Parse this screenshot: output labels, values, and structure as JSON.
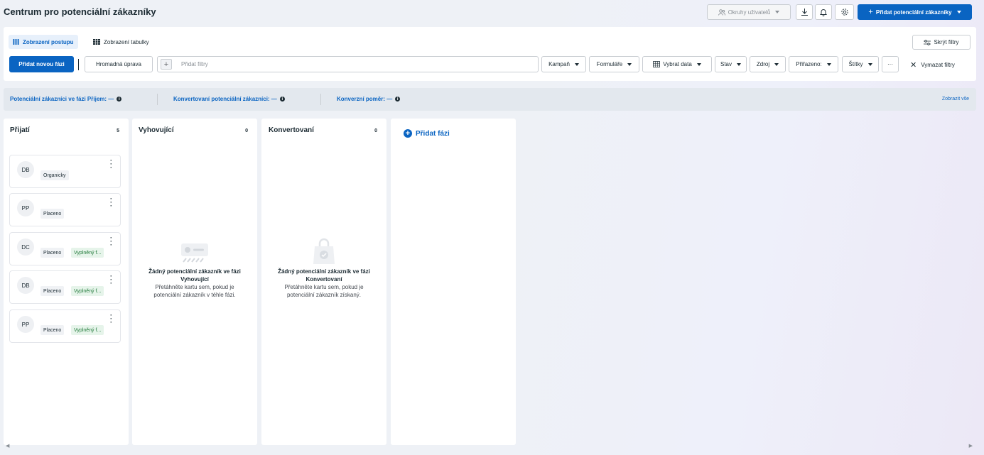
{
  "header": {
    "title": "Centrum pro potenciální zákazníky",
    "audience_btn": "Okruhy uživatelů",
    "add_leads_btn": "Přidat potenciální zákazníky"
  },
  "views": {
    "pipeline": "Zobrazení postupu",
    "table": "Zobrazení tabulky"
  },
  "toolbar": {
    "add_phase_btn": "Přidat novou fázi",
    "bulk_edit_btn": "Hromadná úprava",
    "filter_placeholder": "Přidat filtry",
    "hide_filters_btn": "Skrýt filtry",
    "filters": [
      "Kampaň",
      "Formuláře",
      "Vybrat data",
      "Stav",
      "Zdroj",
      "Přiřazeno:",
      "Štítky"
    ],
    "more_btn": "···",
    "clear_filters": "Vymazat filtry"
  },
  "stats": {
    "received": "Potenciální zákazníci ve fázi Příjem: —",
    "converted": "Konvertovaní potenciální zákazníci: —",
    "rate": "Konverzní poměr: —",
    "show_all": "Zobrazit vše"
  },
  "columns": [
    {
      "title": "Přijatí",
      "count": "5",
      "cards": [
        {
          "initials": "DB",
          "tags": [
            "Organicky"
          ]
        },
        {
          "initials": "PP",
          "tags": [
            "Placeno"
          ]
        },
        {
          "initials": "DC",
          "tags": [
            "Placeno",
            "Vyplněný f..."
          ]
        },
        {
          "initials": "DB",
          "tags": [
            "Placeno",
            "Vyplněný f..."
          ]
        },
        {
          "initials": "PP",
          "tags": [
            "Placeno",
            "Vyplněný f..."
          ]
        }
      ]
    },
    {
      "title": "Vyhovující",
      "count": "0",
      "empty_title": "Žádný potenciální zákazník ve fázi Vyhovující",
      "empty_text": "Přetáhněte kartu sem, pokud je potenciální zákazník v téhle fázi."
    },
    {
      "title": "Konvertovaní",
      "count": "0",
      "empty_title": "Žádný potenciální zákazník ve fázi Konvertovaní",
      "empty_text": "Přetáhněte kartu sem, pokud je potenciální zákazník získaný."
    }
  ],
  "add_phase": "Přidat fázi",
  "colors": {
    "accent": "#0a64c2",
    "tag_green_bg": "#e6f4ea",
    "tag_green_text": "#217a3a"
  }
}
